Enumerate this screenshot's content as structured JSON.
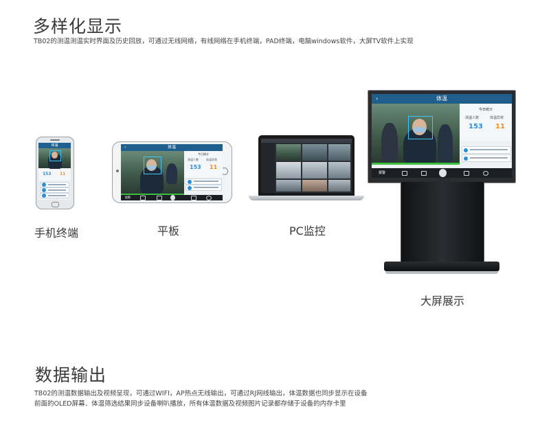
{
  "section1": {
    "title": "多样化显示",
    "desc": "TB02的测温测温实时界面及历史回放，可通过无线网络，有线网络在手机终端，PAD终端，电脑windows软件，大屏TV软件上实现"
  },
  "devices": {
    "phone_label": "手机终端",
    "tablet_label": "平板",
    "pc_label": "PC监控",
    "tv_label": "大屏展示"
  },
  "app_screen": {
    "title": "体温",
    "today_label": "今日统计",
    "count_label": "测温人数",
    "abnormal_label": "体温异常",
    "count_value": "153",
    "abnormal_value": "11",
    "count_color": "#2a8fd8",
    "abnormal_color": "#f08a24",
    "footer_btn": "报警",
    "accent_color": "#1e5f8e"
  },
  "section2": {
    "title": "数据输出",
    "desc_line1": "TB02的测温数据输出及视频呈现，可通过WIFI，AP热点无线输出，可通过RJ网线输出，体温数据也同步显示在设备",
    "desc_line2": "前面的OLED屏幕．体温筛选结果同步设备喇叭播放，所有体温数据及视频图片记录都存储于设备的内存卡里"
  }
}
